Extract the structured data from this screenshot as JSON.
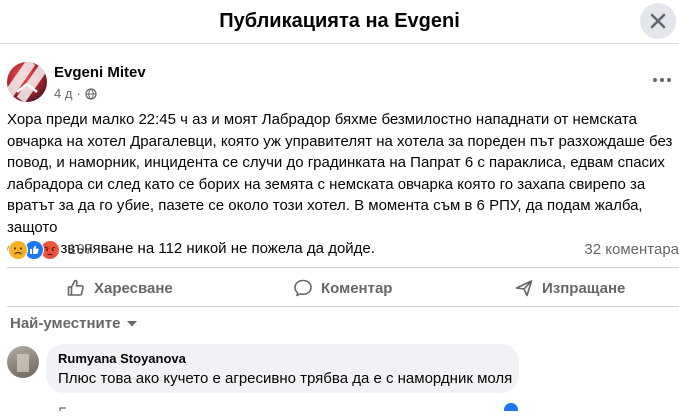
{
  "header": {
    "title": "Публикацията на Evgeni",
    "close_icon": "close-icon"
  },
  "post": {
    "author": "Evgeni Mitev",
    "time": "4 д",
    "privacy_icon": "globe-icon",
    "more_icon": "more-horizontal-icon",
    "text": "Хора преди малко 22:45 ч аз и моят Лабрадор бяхме безмилостно нападнати от немската\nовчарка на хотел Драгалевци, която уж управителят на хотела за пореден път разхождаше без\nповод, и наморник, инцидента се случи до градинката на Папрат 6 с параклиса, едвам спасих\nлабрадора си след като се борих на земята с немската овчарка която го захапа свирепо за\nвратът за да го убие, пазете се около този хотел. В момента съм в 6 РПУ, да подам жалба, защото\nслед позвъняване на 112 никой не пожела да дойде.",
    "reaction_icons": [
      "sad-reaction-icon",
      "like-reaction-icon",
      "angry-reaction-icon"
    ],
    "reaction_count": "107",
    "comments_count": "32 коментара"
  },
  "actions": {
    "like": "Харесване",
    "comment": "Коментар",
    "share": "Изпращане"
  },
  "sort": {
    "label": "Най-уместните"
  },
  "comment": {
    "author": "Rumyana Stoyanova",
    "text": "Плюс това ако кучето е агресивно трябва да е с намордник моля"
  },
  "colors": {
    "secondary_text": "#65676b",
    "bubble": "#f0f2f5",
    "like_blue": "#1877f2",
    "angry": "#f0533c",
    "sad": "#f7b125"
  }
}
